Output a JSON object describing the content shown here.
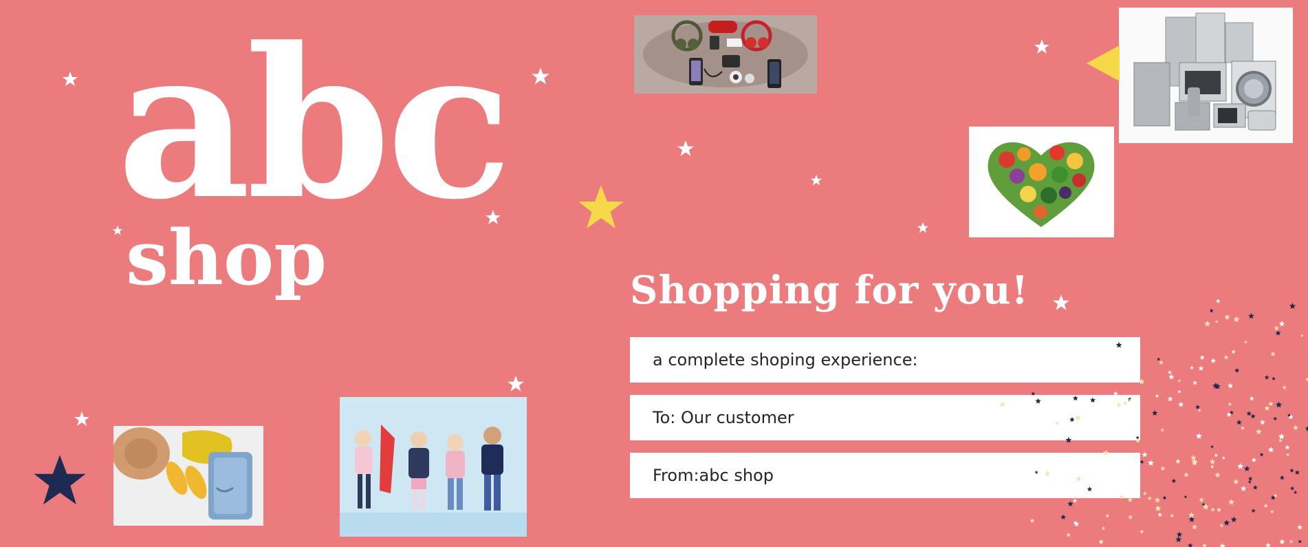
{
  "brand": {
    "abc": "abc",
    "shop": "shop"
  },
  "headline": "Shopping for you!",
  "fields": [
    "a complete shoping experience:",
    "To: Our customer",
    "From:abc shop"
  ],
  "colors": {
    "background": "#ec7b7e",
    "text_on_background": "#ffffff",
    "field_background": "#ffffff",
    "field_text": "#2b2320",
    "star_white": "#ffffff",
    "star_yellow": "#f7d849",
    "star_navy": "#1e2a52",
    "confetti_cream": "#f5e3b0"
  },
  "images": [
    "electronics-flatlay-photo",
    "home-appliances-photo",
    "vegetable-heart-photo",
    "fashion-flatlay-photo",
    "kids-fashion-photo"
  ]
}
